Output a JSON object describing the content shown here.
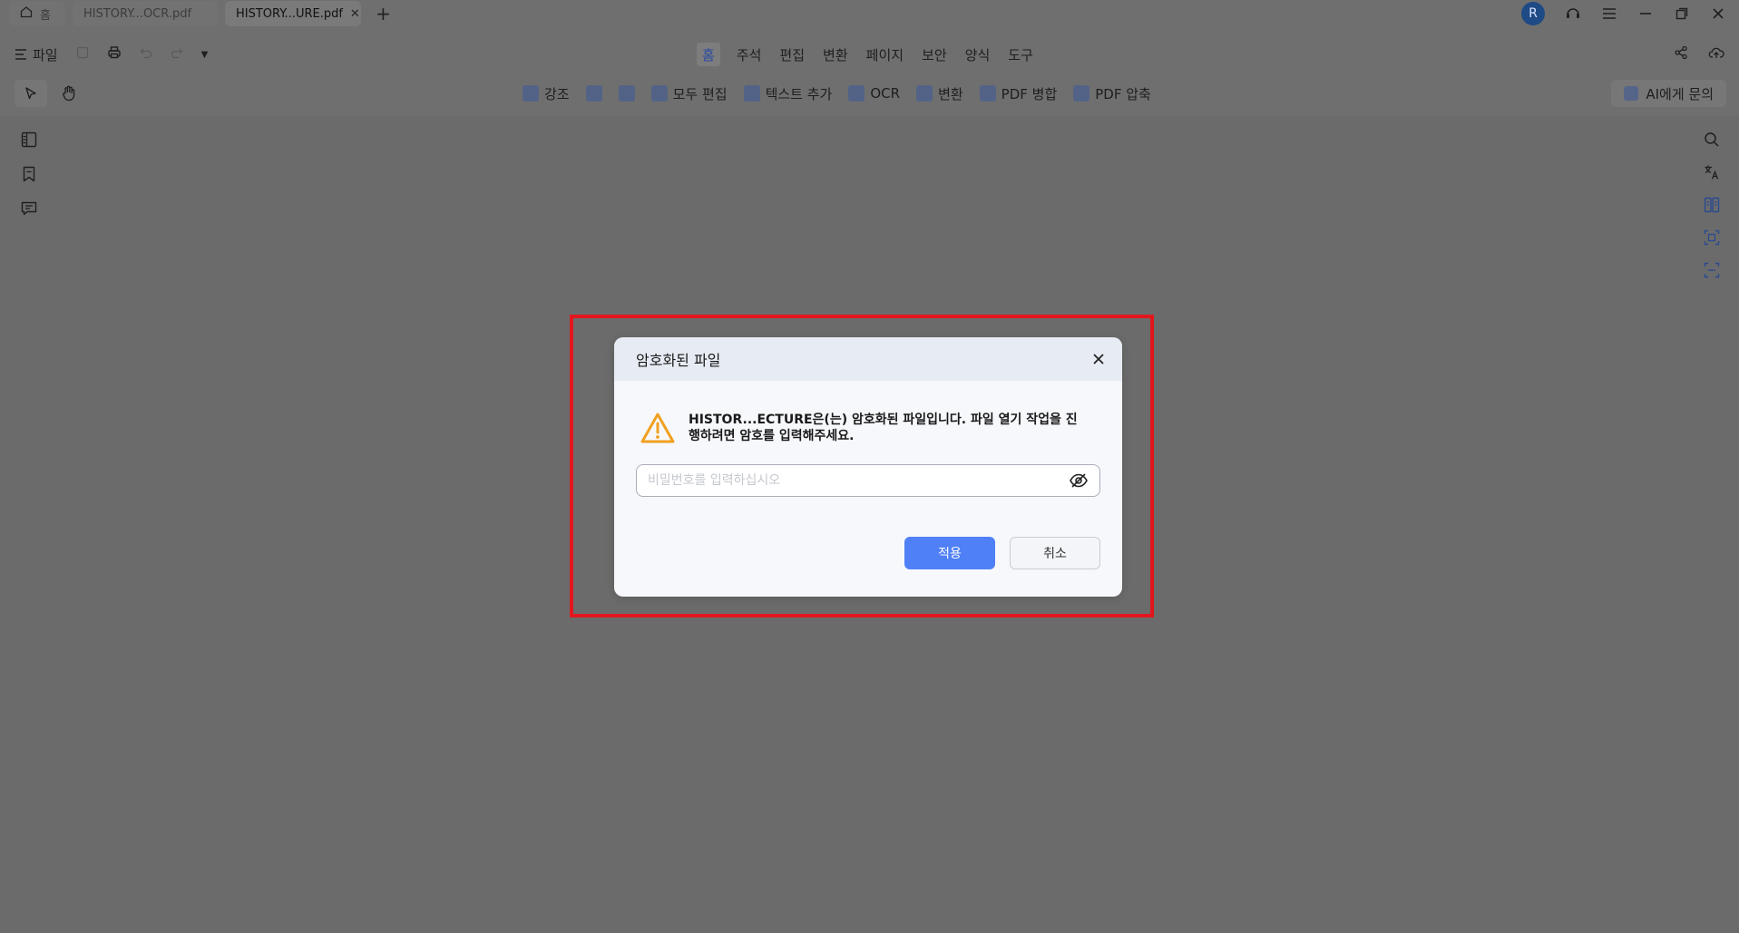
{
  "tabs": [
    {
      "label": "홈",
      "icon": "home-icon"
    },
    {
      "label": "HISTORY...OCR.pdf"
    },
    {
      "label": "HISTORY...URE.pdf",
      "active": true
    }
  ],
  "titlebar": {
    "avatar_initial": "R"
  },
  "menu": {
    "file_label": "파일",
    "items": [
      "홈",
      "주석",
      "편집",
      "변환",
      "페이지",
      "보안",
      "양식",
      "도구"
    ]
  },
  "toolbar": {
    "items": [
      "강조",
      "모두 편집",
      "텍스트 추가",
      "OCR",
      "변환",
      "PDF 병합",
      "PDF 압축"
    ],
    "ai_label": "AI에게 문의"
  },
  "dialog": {
    "title": "암호화된 파일",
    "message": "HISTOR...ECTURE은(는) 암호화된 파일입니다. 파일 열기 작업을 진행하려면 암호를 입력해주세요.",
    "password_placeholder": "비밀번호를 입력하십시오",
    "apply_label": "적용",
    "cancel_label": "취소"
  },
  "colors": {
    "accent": "#4f80f5",
    "highlight": "#e3161e",
    "warning": "#f0a020"
  }
}
